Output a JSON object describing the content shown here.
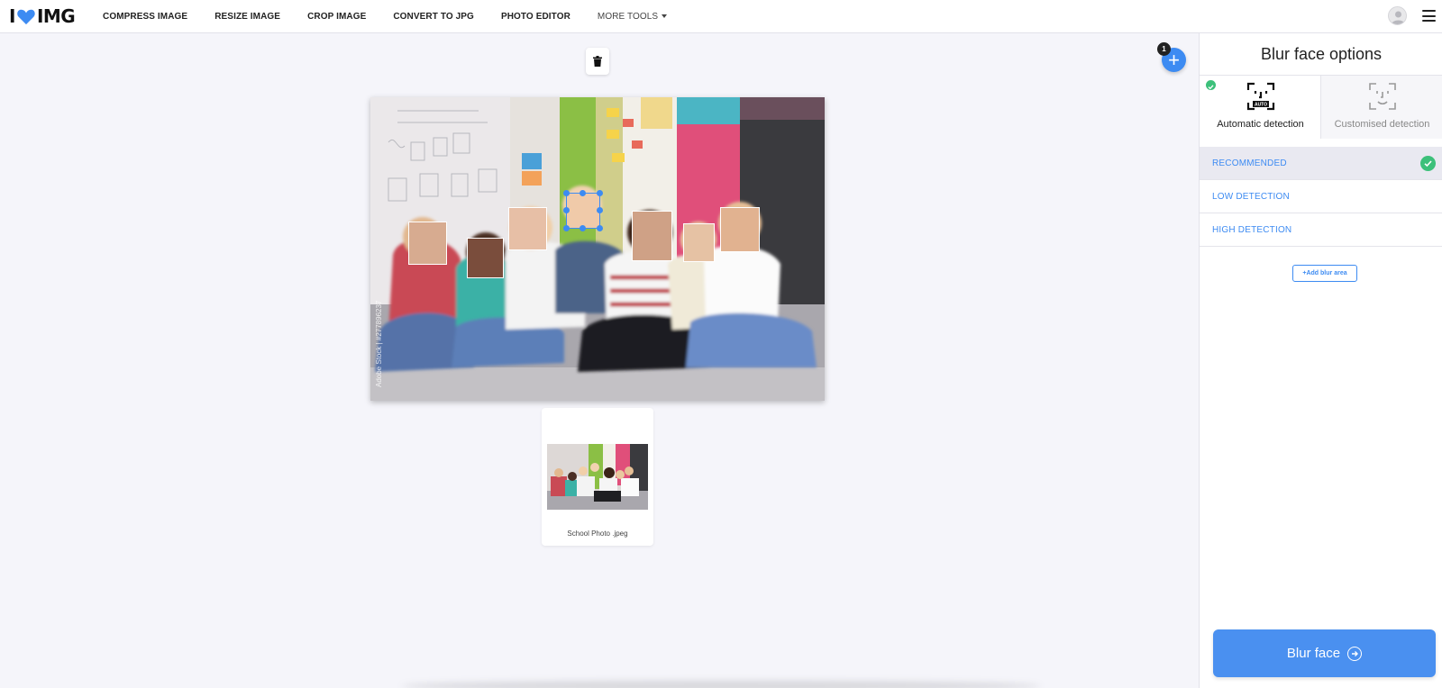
{
  "header": {
    "logo_left": "I",
    "logo_right": "IMG",
    "nav": [
      {
        "label": "COMPRESS IMAGE"
      },
      {
        "label": "RESIZE IMAGE"
      },
      {
        "label": "CROP IMAGE"
      },
      {
        "label": "CONVERT TO JPG"
      },
      {
        "label": "PHOTO EDITOR"
      },
      {
        "label": "MORE TOOLS"
      }
    ]
  },
  "workspace": {
    "file_count_badge": "1",
    "file_name": "School Photo .jpeg",
    "watermark": "Adobe Stock | #277896237"
  },
  "sidebar": {
    "title": "Blur face options",
    "modes": [
      {
        "label": "Automatic detection",
        "icon_text": "AUTO"
      },
      {
        "label": "Customised detection"
      }
    ],
    "options": [
      {
        "label": "RECOMMENDED"
      },
      {
        "label": "LOW DETECTION"
      },
      {
        "label": "HIGH DETECTION"
      }
    ],
    "add_blur_label": "+Add blur area",
    "blur_button_label": "Blur face"
  },
  "colors": {
    "accent": "#3d8bf2",
    "success": "#3cc07a",
    "background": "#f5f5fa"
  }
}
